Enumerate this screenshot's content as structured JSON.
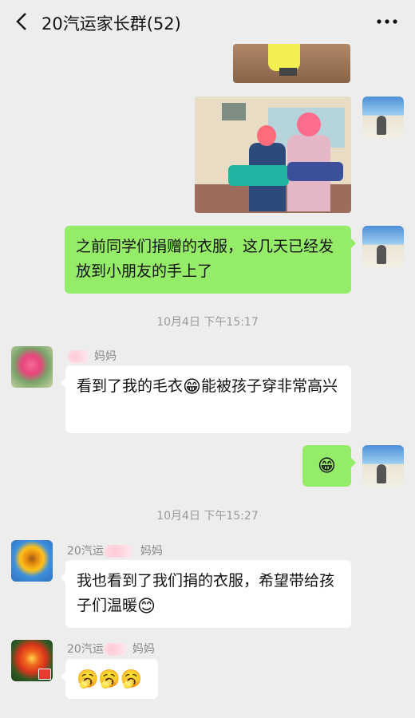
{
  "header": {
    "title": "20汽运家长群(52)",
    "back_icon": "back-chevron-icon",
    "more_icon": "more-dots-icon"
  },
  "messages": {
    "m1": {
      "text": "之前同学们捐赠的衣服，这几天已经发放到小朋友的手上了"
    },
    "t1": "10月4日 下午15:17",
    "m2": {
      "sender": "妈妈",
      "text_a": "看到了我的毛衣",
      "emoji": "😁",
      "text_b": "能被孩子穿非常高兴"
    },
    "m3": {
      "emoji": "😁"
    },
    "t2": "10月4日 下午15:27",
    "m4": {
      "sender_a": "20汽运",
      "sender_b": "妈妈",
      "text": "我也看到了我们捐的衣服，希望带给孩子们温暖",
      "emoji": "😊"
    },
    "m5": {
      "sender_a": "20汽运",
      "sender_b": "妈妈",
      "emojis": "🥱🥱🥱"
    }
  },
  "colors": {
    "green_bubble": "#95ec69",
    "bg": "#ededed"
  }
}
